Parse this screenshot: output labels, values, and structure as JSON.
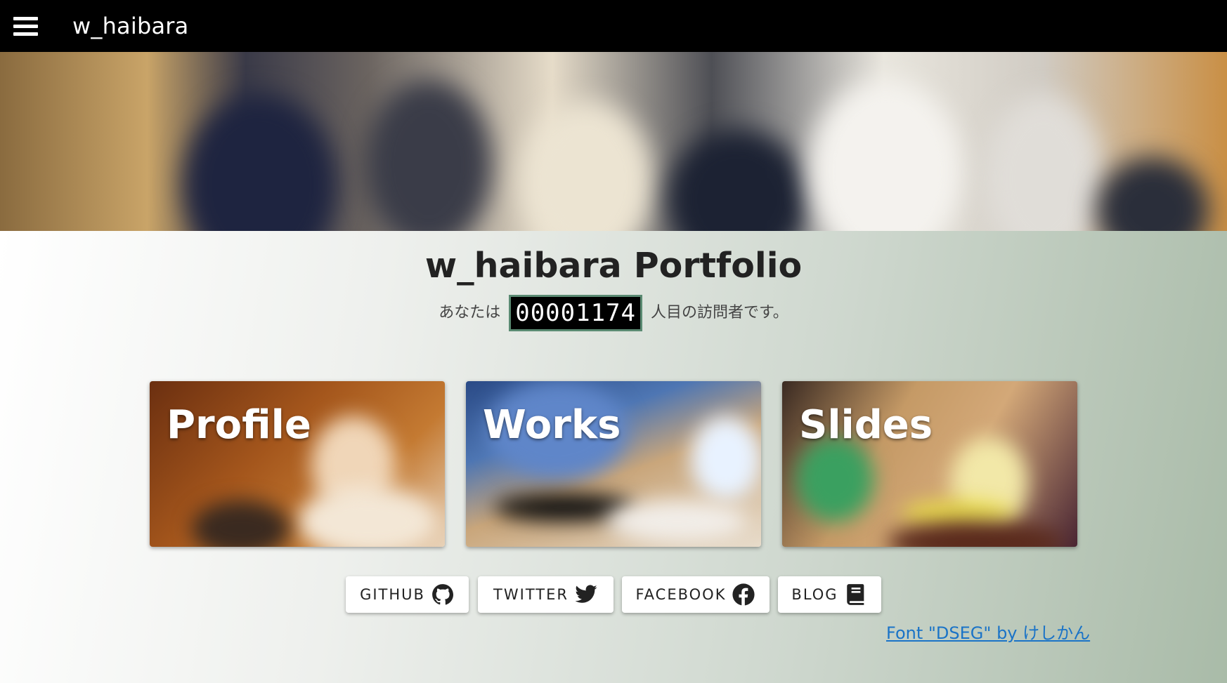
{
  "header": {
    "title": "w_haibara"
  },
  "main": {
    "title": "w_haibara Portfolio",
    "visitor_prefix": "あなたは",
    "visitor_count": "00001174",
    "visitor_suffix": "人目の訪問者です。"
  },
  "cards": [
    {
      "label": "Profile"
    },
    {
      "label": "Works"
    },
    {
      "label": "Slides"
    }
  ],
  "social": [
    {
      "label": "GITHUB",
      "icon": "github-icon"
    },
    {
      "label": "TWITTER",
      "icon": "twitter-icon"
    },
    {
      "label": "FACEBOOK",
      "icon": "facebook-icon"
    },
    {
      "label": "BLOG",
      "icon": "book-icon"
    }
  ],
  "footer": {
    "credit": "Font \"DSEG\" by けしかん"
  },
  "colors": {
    "topbar": "#000000",
    "link": "#1a73c7",
    "counter_border": "#5a8a72"
  }
}
